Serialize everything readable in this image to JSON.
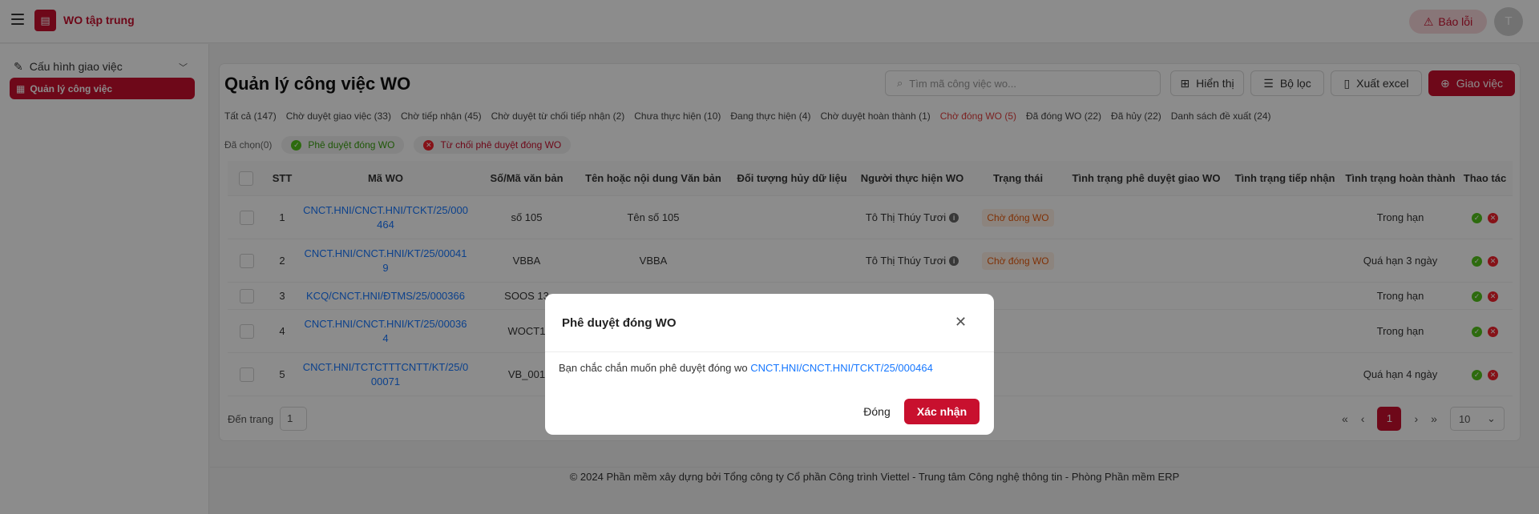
{
  "header": {
    "app_title": "WO tập trung",
    "report_label": "Báo lỗi",
    "avatar_initial": "T"
  },
  "sidebar": {
    "group_label": "Cấu hình giao việc",
    "active_item_label": "Quản lý công việc"
  },
  "main": {
    "title": "Quản lý công việc WO",
    "search_placeholder": "Tìm mã công việc wo...",
    "buttons": {
      "display": "Hiển thị",
      "filter": "Bộ lọc",
      "export": "Xuất excel",
      "assign": "Giao việc"
    },
    "tabs": [
      "Tất cả (147)",
      "Chờ duyệt giao việc (33)",
      "Chờ tiếp nhận (45)",
      "Chờ duyệt từ chối tiếp nhận (2)",
      "Chưa thực hiện (10)",
      "Đang thực hiện (4)",
      "Chờ duyệt hoàn thành (1)",
      "Chờ đóng WO (5)",
      "Đã đóng WO (22)",
      "Đã hủy (22)",
      "Danh sách đề xuất (24)"
    ],
    "active_tab": "Chờ đóng WO (5)",
    "selected_label": "Đã chọn(0)",
    "approve_close_label": "Phê duyệt đóng WO",
    "reject_close_label": "Từ chối phê duyệt đóng WO"
  },
  "table": {
    "columns": [
      "STT",
      "Mã WO",
      "Số/Mã văn bản",
      "Tên hoặc nội dung Văn bản",
      "Đối tượng hủy dữ liệu",
      "Người thực hiện WO",
      "Trạng thái",
      "Tình trạng phê duyệt giao WO",
      "Tình trạng tiếp nhận",
      "Tình trạng hoàn thành",
      "Thao tác"
    ],
    "rows": [
      {
        "stt": "1",
        "ma_wo_l1": "CNCT.HNI/CNCT.HNI/TCKT/25/000",
        "ma_wo_l2": "464",
        "so_vb": "số 105",
        "ten_vb": "Tên số 105",
        "nguoi_th": "Tô Thị Thúy Tươi",
        "trang_thai": "Chờ đóng WO",
        "hoan_thanh": "Trong hạn"
      },
      {
        "stt": "2",
        "ma_wo_l1": "CNCT.HNI/CNCT.HNI/KT/25/00041",
        "ma_wo_l2": "9",
        "so_vb": "VBBA",
        "ten_vb": "VBBA",
        "nguoi_th": "Tô Thị Thúy Tươi",
        "trang_thai": "Chờ đóng WO",
        "hoan_thanh": "Quá hạn 3 ngày"
      },
      {
        "stt": "3",
        "ma_wo_l1": "KCQ/CNCT.HNI/ĐTMS/25/000366",
        "ma_wo_l2": "",
        "so_vb": "SOOS 13",
        "ten_vb": "",
        "nguoi_th": "",
        "trang_thai": "",
        "hoan_thanh": "Trong hạn"
      },
      {
        "stt": "4",
        "ma_wo_l1": "CNCT.HNI/CNCT.HNI/KT/25/00036",
        "ma_wo_l2": "4",
        "so_vb": "WOCT1",
        "ten_vb": "",
        "nguoi_th": "",
        "trang_thai": "",
        "hoan_thanh": "Trong hạn"
      },
      {
        "stt": "5",
        "ma_wo_l1": "CNCT.HNI/TCTCTTTCNTT/KT/25/0",
        "ma_wo_l2": "00071",
        "so_vb": "VB_001",
        "ten_vb": "",
        "nguoi_th": "",
        "trang_thai": "",
        "hoan_thanh": "Quá hạn 4 ngày"
      }
    ]
  },
  "pagination": {
    "goto_label": "Đến trang",
    "goto_value": "1",
    "current_page": "1",
    "page_size": "10"
  },
  "footer": {
    "text": "© 2024 Phần mềm xây dựng bởi Tổng công ty Cổ phần Công trình Viettel - Trung tâm Công nghệ thông tin - Phòng Phần mềm ERP"
  },
  "modal": {
    "title": "Phê duyệt đóng WO",
    "message": "Bạn chắc chắn muốn phê duyệt đóng wo",
    "wo_code": "CNCT.HNI/CNCT.HNI/TCKT/25/000464",
    "close_label": "Đóng",
    "confirm_label": "Xác nhận"
  },
  "colors": {
    "brand": "#c8102e",
    "link": "#1677ff",
    "status_orange": "#e8590c"
  }
}
